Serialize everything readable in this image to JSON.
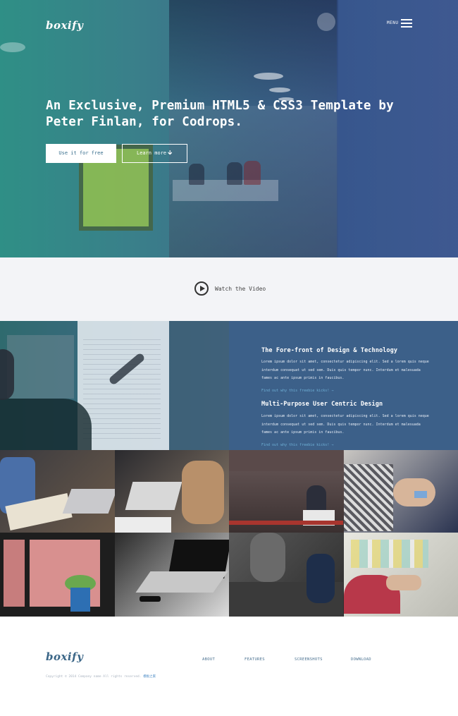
{
  "brand": {
    "logo": "boxify"
  },
  "header": {
    "menu_label": "MENU"
  },
  "hero": {
    "title": "An Exclusive, Premium HTML5 & CSS3 Template by Peter Finlan, for Codrops.",
    "primary_button": "Use it for free",
    "secondary_button": "Learn more"
  },
  "video": {
    "label": "Watch the Video"
  },
  "features": [
    {
      "title": "The Fore-front of Design & Technology",
      "text": "Lorem ipsum dolor sit amet, consectetur adipiscing elit. Sed a lorem quis neque interdum consequat ut sed sem. Duis quis tempor nunc. Interdum et malesuada fames ac ante ipsum primis in faucibus.",
      "link": "Find out why this freebie kicks! →"
    },
    {
      "title": "Multi-Purpose User Centric Design",
      "text": "Lorem ipsum dolor sit amet, consectetur adipiscing elit. Sed a lorem quis neque interdum consequat ut sed sem. Duis quis tempor nunc. Interdum et malesuada fames ac ante ipsum primis in faucibus.",
      "link": "Find out why this freebie kicks! →"
    }
  ],
  "footer": {
    "logo": "boxify",
    "nav": [
      "ABOUT",
      "FEATURES",
      "SCREENSHOTS",
      "DOWNLOAD"
    ],
    "copyright": "Copyright © 2014 Company name All rights reserved.",
    "copyright_link": "模板之家"
  },
  "colors": {
    "feature_bg": "#3c6089",
    "video_bg": "#f3f4f7",
    "link": "#6fb0d6",
    "footer_text": "#4a7190"
  }
}
